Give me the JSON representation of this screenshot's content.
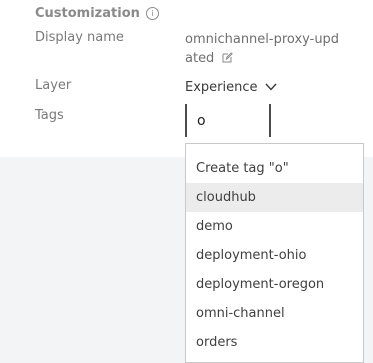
{
  "section": {
    "title": "Customization"
  },
  "fields": {
    "display_name": {
      "label": "Display name",
      "value": "omnichannel-proxy-updated"
    },
    "layer": {
      "label": "Layer",
      "value": "Experience"
    },
    "tags": {
      "label": "Tags",
      "input_value": "o"
    }
  },
  "dropdown": {
    "create_item": "Create tag \"o\"",
    "items": [
      "cloudhub",
      "demo",
      "deployment-ohio",
      "deployment-oregon",
      "omni-channel",
      "orders"
    ]
  },
  "icons": {
    "info": "info-icon",
    "edit": "edit-icon",
    "chevron": "chevron-down-icon"
  },
  "colors": {
    "label": "#7a7a7a",
    "highlight": "#ececec",
    "background_gray": "#f3f4f6"
  }
}
